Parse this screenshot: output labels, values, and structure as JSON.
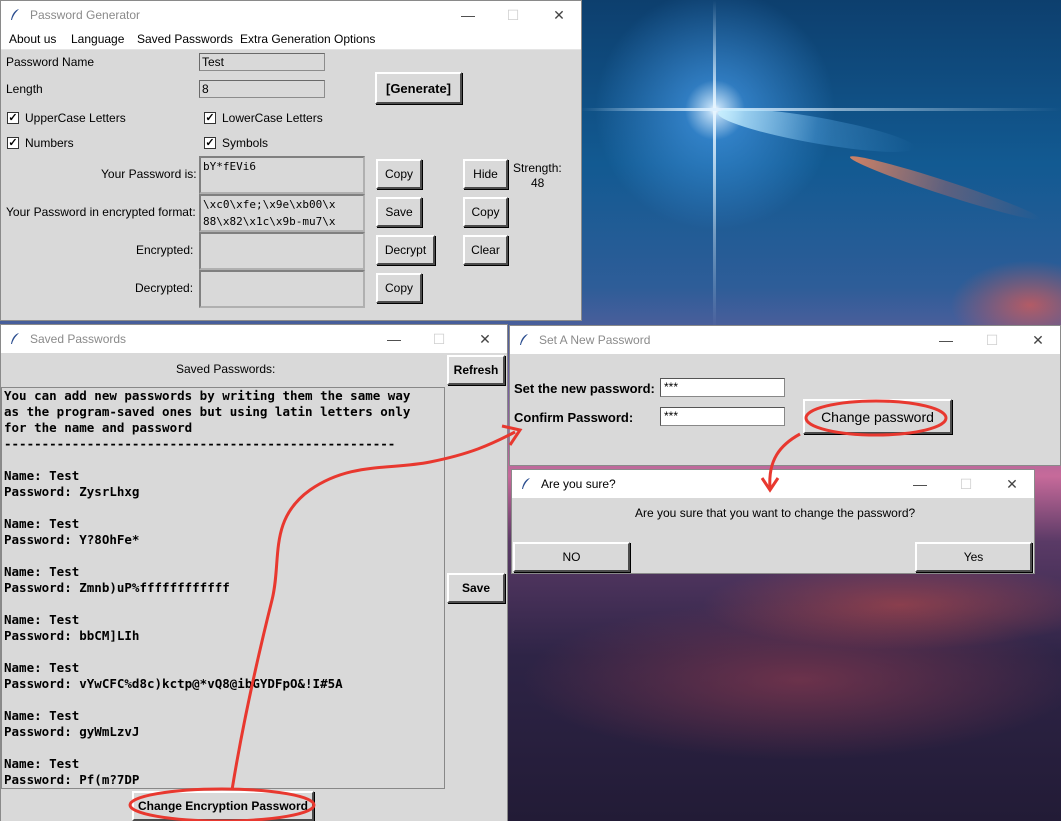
{
  "colors": {
    "accent_annotation": "#e8382f",
    "window_bg": "#d9d9d9"
  },
  "generator": {
    "title": "Password Generator",
    "menu": [
      "About us",
      "Language",
      "Saved Passwords",
      "Extra Generation Options"
    ],
    "password_name_label": "Password Name",
    "password_name_value": "Test",
    "length_label": "Length",
    "length_value": "8",
    "generate_label": "[Generate]",
    "uppercase_label": "UpperCase Letters",
    "lowercase_label": "LowerCase Letters",
    "numbers_label": "Numbers",
    "symbols_label": "Symbols",
    "checkbox_mark": "✓",
    "your_password_label": "Your Password is:",
    "your_password_value": "bY*fEVi6",
    "encrypted_format_label": "Your Password in encrypted format:",
    "encrypted_format_value": "\\xc0\\xfe;\\x9e\\xb00\\x\n88\\x82\\x1c\\x9b-mu7\\x",
    "encrypted_label": "Encrypted:",
    "decrypted_label": "Decrypted:",
    "copy_label": "Copy",
    "save_label": "Save",
    "decrypt_label": "Decrypt",
    "copy2_label": "Copy",
    "hide_label": "Hide",
    "copy3_label": "Copy",
    "clear_label": "Clear",
    "strength_label": "Strength:",
    "strength_value": "48"
  },
  "saved": {
    "title": "Saved Passwords",
    "header": "Saved Passwords:",
    "refresh_label": "Refresh",
    "save_label": "Save",
    "change_encryption_label": "Change Encryption Password",
    "text": "You can add new passwords by writing them the same way\nas the program-saved ones but using latin letters only\nfor the name and password\n----------------------------------------------------\n\nName: Test\nPassword: ZysrLhxg\n\nName: Test\nPassword: Y?8OhFe*\n\nName: Test\nPassword: Zmnb)uP%ffffffffffff\n\nName: Test\nPassword: bbCM]LIh\n\nName: Test\nPassword: vYwCFC%d8c)kctp@*vQ8@ibGYDFpO&!I#5A\n\nName: Test\nPassword: gyWmLzvJ\n\nName: Test\nPassword: Pf(m?7DP"
  },
  "newpass": {
    "title": "Set A New Password",
    "set_label": "Set the new password:",
    "set_value": "***",
    "confirm_label": "Confirm Password:",
    "confirm_value": "***",
    "change_label": "Change password"
  },
  "confirm": {
    "title": "Are you sure?",
    "message": "Are you sure that you want to change the password?",
    "no_label": "NO",
    "yes_label": "Yes"
  },
  "window_controls": {
    "minimize": "—",
    "maximize": "☐",
    "close": "✕"
  }
}
